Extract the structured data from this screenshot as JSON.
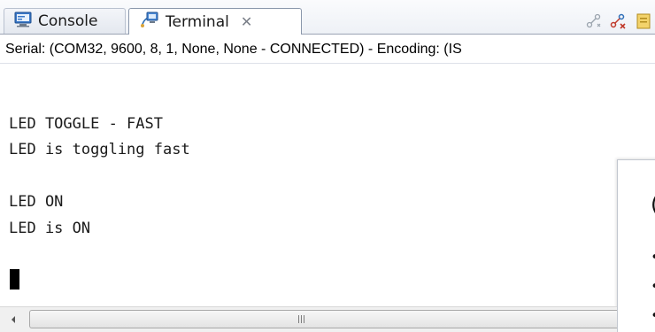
{
  "tabs": [
    {
      "label": "Console",
      "icon": "console-icon",
      "active": false
    },
    {
      "label": "Terminal",
      "icon": "terminal-icon",
      "active": true,
      "close_glyph": "✕"
    }
  ],
  "toolbar": {
    "buttons": [
      "connect-icon",
      "disconnect-icon",
      "settings-icon"
    ]
  },
  "status": {
    "text": "Serial: (COM32, 9600, 8, 1, None, None - CONNECTED) - Encoding: (IS"
  },
  "terminal": {
    "lines": [
      "LED TOGGLE - FAST",
      "LED is toggling fast",
      "",
      "LED ON",
      "LED is ON"
    ]
  },
  "overlay": {
    "visible_char": "(",
    "bullets": [
      "•",
      "•",
      "•"
    ]
  },
  "colors": {
    "tab_border": "#8a97ab",
    "text": "#1b1b1b",
    "terminal_bg": "#ffffff"
  }
}
